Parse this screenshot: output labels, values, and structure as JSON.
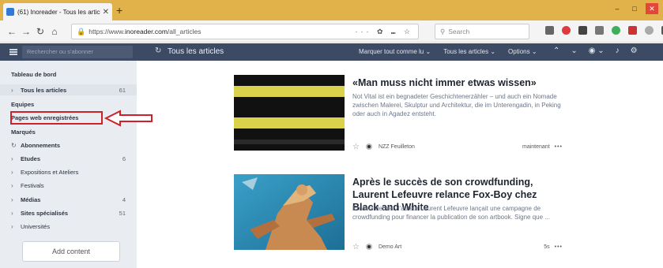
{
  "browser": {
    "tab_title": "(61) Inoreader - Tous les articl",
    "tab_close": "✕",
    "new_tab": "+",
    "url_prefix": "https://www.",
    "url_host": "inoreader.com",
    "url_path": "/all_articles",
    "url_actions": "··· ✿ ⑉ ☆",
    "search_placeholder": "Search",
    "window_controls": [
      "–",
      "□",
      "✕"
    ]
  },
  "appbar": {
    "search_placeholder": "Rechercher ou s'abonner",
    "refresh_icon": "↻",
    "title": "Tous les articles",
    "actions": [
      "Marquer tout comme lu  ⌄",
      "Tous les articles  ⌄",
      "Options  ⌄"
    ],
    "icons": [
      "⌃",
      "⌄",
      "◉ ⌄",
      "♪",
      "⚙"
    ]
  },
  "sidebar": {
    "items": [
      {
        "label": "Tableau de bord",
        "count": "",
        "chev": ""
      },
      {
        "label": "Tous les articles",
        "count": "61",
        "chev": "›"
      },
      {
        "label": "Equipes",
        "count": "",
        "chev": ""
      },
      {
        "label": "Pages web enregistrées",
        "count": "",
        "chev": ""
      },
      {
        "label": "Marqués",
        "count": "",
        "chev": ""
      },
      {
        "label": "Abonnements",
        "count": "",
        "chev": "↻"
      },
      {
        "label": "Etudes",
        "count": "6",
        "chev": "›"
      },
      {
        "label": "Expositions et Ateliers",
        "count": "",
        "chev": "›"
      },
      {
        "label": "Festivals",
        "count": "",
        "chev": "›"
      },
      {
        "label": "Médias",
        "count": "4",
        "chev": "›"
      },
      {
        "label": "Sites spécialisés",
        "count": "51",
        "chev": "›"
      },
      {
        "label": "Universités",
        "count": "",
        "chev": "›"
      }
    ],
    "add_content": "Add content"
  },
  "articles": [
    {
      "title": "«Man muss nicht immer etwas wissen»",
      "body": "Not Vital ist ein begnadeter Geschichtenerzähler – und auch ein Nomade zwischen Malerei, Skulptur und Architektur, die im Unterengadin, in Peking oder auch in Agadez entsteht.",
      "source": "NZZ Feuilleton",
      "time": "maintenant",
      "more": "•••"
    },
    {
      "title": "Après le succès de son crowdfunding, Laurent Lefeuvre relance Fox-Boy chez Black and White",
      "body": "En avril dernier, l'auteur Laurent Lefeuvre lançait une campagne de crowdfunding pour financer la publication de son artbook. Signe que ...",
      "source": "Demo Art",
      "time": "5s",
      "more": "•••"
    }
  ],
  "colors": {
    "tabbar": "#e2b24a",
    "appbar": "#3c4a63",
    "sidebar": "#e9edf2",
    "highlight": "#d0202a"
  }
}
